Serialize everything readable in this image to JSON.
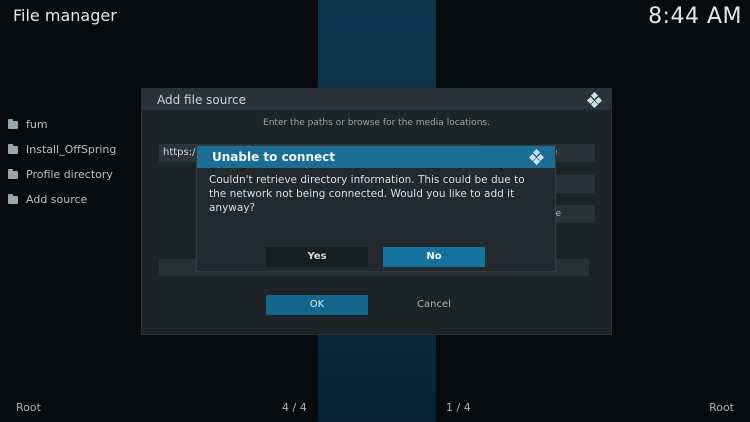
{
  "header": {
    "title": "File manager",
    "clock": "8:44 AM"
  },
  "sidebar": {
    "items": [
      {
        "label": "fum"
      },
      {
        "label": "Install_OffSpring"
      },
      {
        "label": "Profile directory"
      },
      {
        "label": "Add source"
      }
    ]
  },
  "add_source_dialog": {
    "title": "Add file source",
    "instruction": "Enter the paths or browse for the media locations.",
    "path_value": "https:/",
    "side_buttons": [
      "e",
      "",
      "re"
    ],
    "ok_label": "OK",
    "cancel_label": "Cancel"
  },
  "error_dialog": {
    "title": "Unable to connect",
    "message": "Couldn't retrieve directory information. This could be due to the network not being connected. Would you like to add it anyway?",
    "yes_label": "Yes",
    "no_label": "No"
  },
  "footer": {
    "left": "Root",
    "page_left": "4 / 4",
    "page_right": "1 / 4",
    "right": "Root"
  },
  "colors": {
    "accent": "#12668c",
    "background": "#070a0c"
  }
}
